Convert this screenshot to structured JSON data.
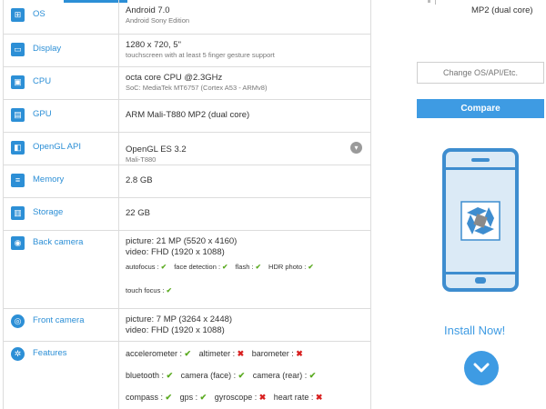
{
  "specs": {
    "os": {
      "label": "OS",
      "icon": "os-icon",
      "value": "Android 7.0",
      "sub": "Android Sony Edition"
    },
    "display": {
      "label": "Display",
      "icon": "display-icon",
      "value": "1280 x 720, 5\"",
      "sub": "touchscreen with at least 5 finger gesture support"
    },
    "cpu": {
      "label": "CPU",
      "icon": "cpu-icon",
      "value": "octa core CPU @2.3GHz",
      "sub": "SoC: MediaTek MT6757 (Cortex A53 - ARMv8)"
    },
    "gpu": {
      "label": "GPU",
      "icon": "gpu-icon",
      "value": "ARM Mali-T880 MP2 (dual core)"
    },
    "opengl": {
      "label": "OpenGL API",
      "icon": "opengl-icon",
      "value": "OpenGL ES 3.2",
      "sub": "Mali-T880"
    },
    "memory": {
      "label": "Memory",
      "icon": "memory-icon",
      "value": "2.8 GB"
    },
    "storage": {
      "label": "Storage",
      "icon": "storage-icon",
      "value": "22 GB"
    },
    "back_camera": {
      "label": "Back camera",
      "icon": "camera-icon",
      "picture": "picture: 21 MP (5520 x 4160)",
      "video": "video: FHD (1920 x 1088)",
      "features": [
        {
          "name": "autofocus :",
          "ok": "✔"
        },
        {
          "name": "face detection :",
          "ok": "✔"
        },
        {
          "name": "flash :",
          "ok": "✔"
        },
        {
          "name": "HDR photo :",
          "ok": "✔"
        }
      ],
      "features2": [
        {
          "name": "touch focus :",
          "ok": "✔"
        }
      ]
    },
    "front_camera": {
      "label": "Front camera",
      "icon": "front-camera-icon",
      "picture": "picture: 7 MP (3264 x 2448)",
      "video": "video: FHD (1920 x 1088)"
    },
    "features": {
      "label": "Features",
      "icon": "gear-icon",
      "line1": [
        {
          "name": "accelerometer :",
          "mark": "✔",
          "state": "ok"
        },
        {
          "name": "altimeter :",
          "mark": "✖",
          "state": "no"
        },
        {
          "name": "barometer :",
          "mark": "✖",
          "state": "no"
        }
      ],
      "line2": [
        {
          "name": "bluetooth :",
          "mark": "✔",
          "state": "ok"
        },
        {
          "name": "camera (face) :",
          "mark": "✔",
          "state": "ok"
        },
        {
          "name": "camera (rear) :",
          "mark": "✔",
          "state": "ok"
        }
      ],
      "line3": [
        {
          "name": "compass :",
          "mark": "✔",
          "state": "ok"
        },
        {
          "name": "gps :",
          "mark": "✔",
          "state": "ok"
        },
        {
          "name": "gyroscope :",
          "mark": "✖",
          "state": "no"
        },
        {
          "name": "heart rate :",
          "mark": "✖",
          "state": "no"
        }
      ]
    }
  },
  "sidebar": {
    "gpu_summary": "MP2 (dual core)",
    "compare_placeholder": "Change OS/API/Etc.",
    "compare_label": "Compare",
    "install_label": "Install Now!"
  },
  "colors": {
    "accent": "#2c8fd6",
    "ok": "#5aaa20",
    "no": "#d82020"
  }
}
